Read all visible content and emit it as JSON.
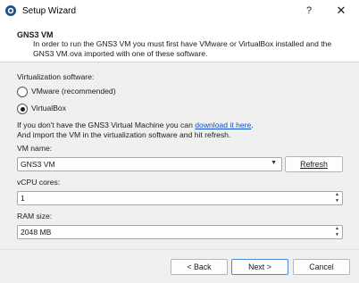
{
  "window": {
    "title": "Setup Wizard",
    "help_icon": "?",
    "close_icon": "✕"
  },
  "header": {
    "title": "GNS3 VM",
    "subtitle": "In order to run the GNS3 VM you must first have VMware or VirtualBox installed and the GNS3 VM.ova imported with one of these software."
  },
  "virtualization": {
    "label": "Virtualization software:",
    "options": [
      {
        "label": "VMware (recommended)",
        "selected": false
      },
      {
        "label": "VirtualBox",
        "selected": true
      }
    ]
  },
  "info": {
    "line1_prefix": "If you don't have the GNS3 Virtual Machine you can ",
    "link": "download it here",
    "line1_suffix": ".",
    "line2": "And import the VM in the virtualization software and hit refresh."
  },
  "vm_name": {
    "label": "VM name:",
    "value": "GNS3 VM",
    "refresh_label": "Refresh"
  },
  "vcpu": {
    "label": "vCPU cores:",
    "value": "1"
  },
  "ram": {
    "label": "RAM size:",
    "value": "2048 MB"
  },
  "footer": {
    "back_label": "< Back",
    "next_label": "Next >",
    "cancel_label": "Cancel"
  },
  "colors": {
    "accent": "#4a8ad8",
    "link": "#0a50c8"
  }
}
